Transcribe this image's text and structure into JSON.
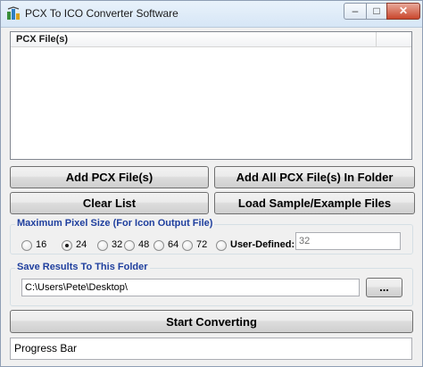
{
  "window": {
    "title": "PCX To ICO Converter Software",
    "minimize_glyph": "–",
    "maximize_glyph": "□",
    "close_glyph": "✕"
  },
  "file_list": {
    "column_header": "PCX File(s)",
    "rows": []
  },
  "buttons": {
    "add_files": "Add PCX File(s)",
    "add_folder": "Add All PCX File(s) In Folder",
    "clear_list": "Clear List",
    "load_sample": "Load Sample/Example Files",
    "browse": "...",
    "start": "Start Converting"
  },
  "pixel_size": {
    "group_label": "Maximum Pixel Size (For Icon Output File)",
    "options": [
      "16",
      "24",
      "32",
      "48",
      "64",
      "72"
    ],
    "selected": "24",
    "user_defined_label": "User-Defined:",
    "user_defined_value": "32"
  },
  "save_folder": {
    "group_label": "Save Results To This Folder",
    "path": "C:\\Users\\Pete\\Desktop\\"
  },
  "progress": {
    "label": "Progress Bar"
  },
  "icons": {
    "app": "app-converter-icon",
    "minimize": "minimize-icon",
    "maximize": "maximize-icon",
    "close": "close-icon"
  }
}
